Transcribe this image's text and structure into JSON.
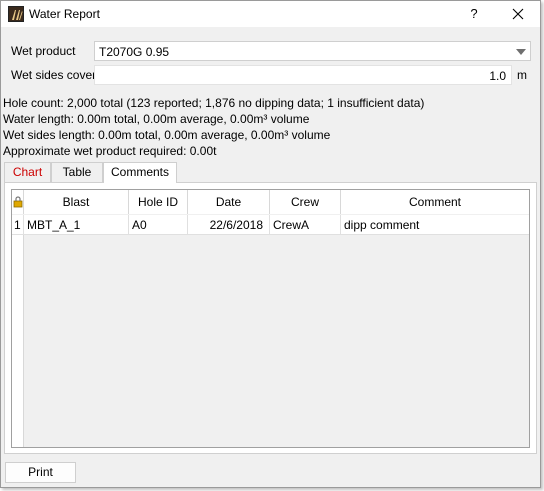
{
  "window": {
    "title": "Water Report",
    "help_label": "?",
    "close_icon": "close-icon",
    "app_icon": "app-logo-icon"
  },
  "form": {
    "wet_product_label": "Wet product",
    "wet_product_value": "T2070G 0.95",
    "wet_sides_label": "Wet sides cover",
    "wet_sides_value": "1.0",
    "wet_sides_unit": "m"
  },
  "summary": {
    "hole_count": "Hole count: 2,000 total (123 reported; 1,876 no dipping data; 1 insufficient data)",
    "water_length": "Water length: 0.00m total, 0.00m average, 0.00m³ volume",
    "wet_sides_length": "Wet sides length: 0.00m total, 0.00m average, 0.00m³ volume",
    "wet_product_required": "Approximate wet product required: 0.00t"
  },
  "tabs": [
    {
      "label": "Chart",
      "color": "#cc0000"
    },
    {
      "label": "Table"
    },
    {
      "label": "Comments",
      "active": true
    }
  ],
  "table": {
    "lock_icon": "lock-icon",
    "columns": [
      "Blast",
      "Hole ID",
      "Date",
      "Crew",
      "Comment"
    ],
    "rows": [
      {
        "num": "1",
        "blast": "MBT_A_1",
        "hole_id": "A0",
        "date": "22/6/2018",
        "crew": "CrewA",
        "comment": "dipp comment"
      }
    ]
  },
  "footer": {
    "print_label": "Print"
  }
}
